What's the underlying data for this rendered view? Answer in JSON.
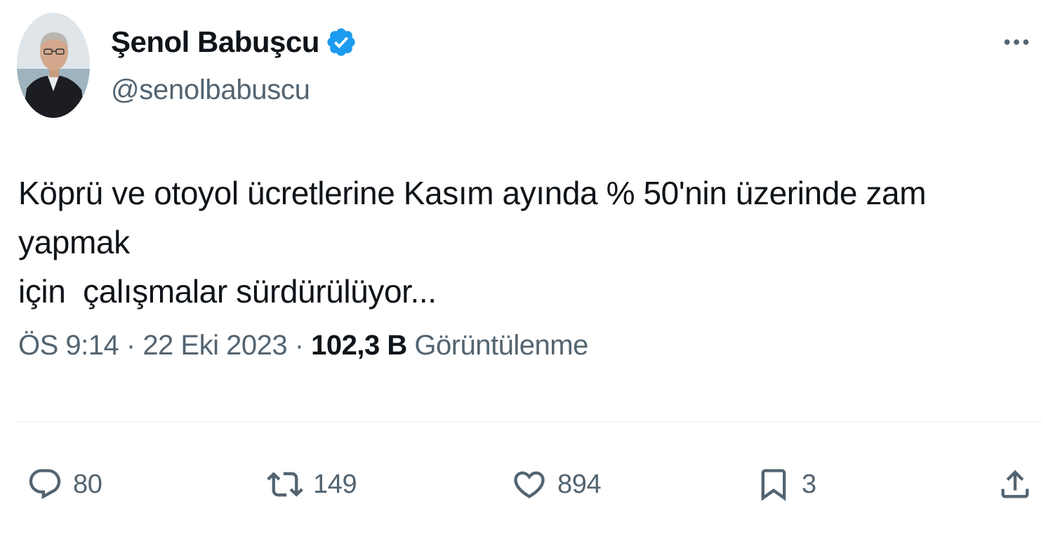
{
  "author": {
    "display_name": "Şenol Babuşcu",
    "handle": "@senolbabuscu",
    "verified": true
  },
  "tweet": {
    "text": "Köprü ve otoyol ücretlerine Kasım ayında % 50'nin üzerinde zam yapmak\niçin  çalışmalar sürdürülüyor..."
  },
  "meta": {
    "time": "ÖS 9:14",
    "separator": " · ",
    "date": "22 Eki 2023",
    "views_count": "102,3 B",
    "views_label": " Görüntülenme"
  },
  "actions": {
    "reply_count": "80",
    "retweet_count": "149",
    "like_count": "894",
    "bookmark_count": "3"
  },
  "icons": {
    "more": "more-horizontal-icon",
    "verified": "verified-badge-icon",
    "reply": "reply-icon",
    "retweet": "retweet-icon",
    "like": "heart-icon",
    "bookmark": "bookmark-icon",
    "share": "share-icon"
  },
  "colors": {
    "text_primary": "#0f1419",
    "text_secondary": "#536471",
    "verified_blue": "#1d9bf0",
    "divider": "#eff3f4"
  }
}
